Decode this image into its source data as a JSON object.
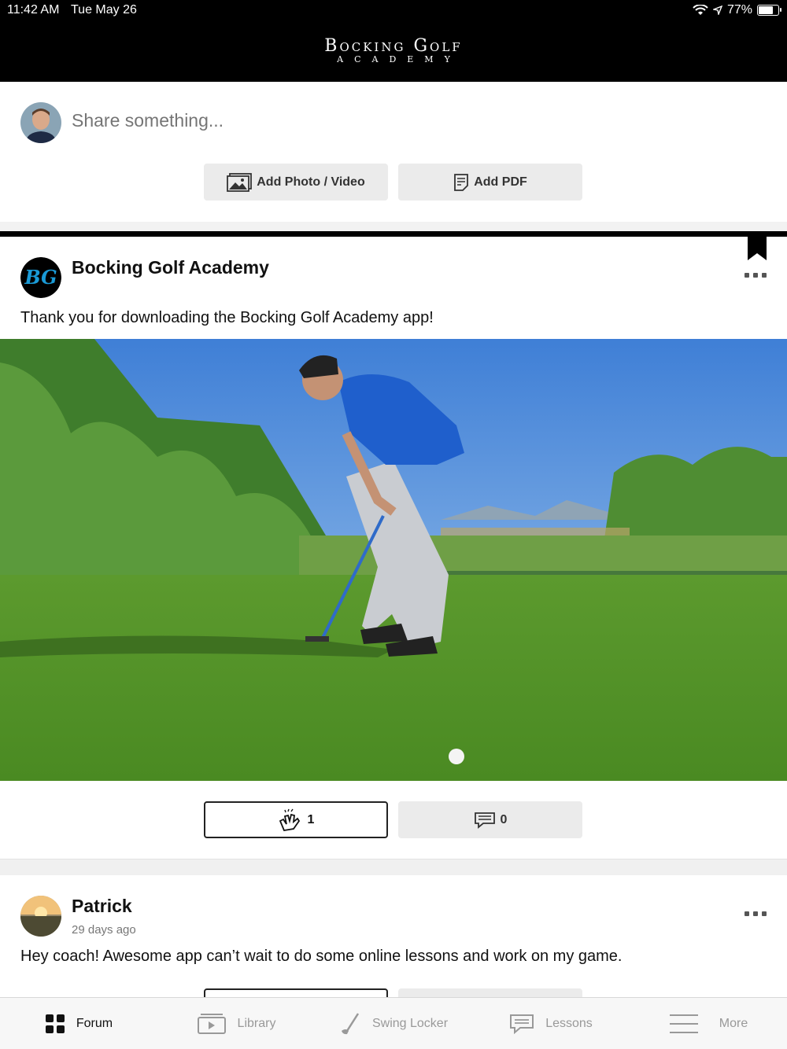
{
  "status": {
    "time": "11:42 AM",
    "date": "Tue May 26",
    "battery": "77%",
    "battery_level": 0.77
  },
  "header": {
    "logo_main": "Bocking Golf",
    "logo_sub": "ACADEMY"
  },
  "composer": {
    "placeholder": "Share something...",
    "add_photo_label": "Add Photo / Video",
    "add_pdf_label": "Add PDF"
  },
  "posts": [
    {
      "author": "Bocking Golf Academy",
      "text": "Thank you for downloading the Bocking Golf Academy app!",
      "clap_count": "1",
      "comment_count": "0"
    },
    {
      "author": "Patrick",
      "time": "29 days ago",
      "text": "Hey coach! Awesome app can’t wait to do some online lessons and work on my game."
    }
  ],
  "tabs": [
    {
      "label": "Forum",
      "icon": "grid-icon",
      "active": true
    },
    {
      "label": "Library",
      "icon": "video-folder-icon",
      "active": false
    },
    {
      "label": "Swing Locker",
      "icon": "golf-club-icon",
      "active": false
    },
    {
      "label": "Lessons",
      "icon": "chat-icon",
      "active": false
    },
    {
      "label": "More",
      "icon": "menu-icon",
      "active": false
    }
  ],
  "colors": {
    "header_bg": "#000000",
    "brand_blue": "#1a9ad6",
    "button_gray": "#ebebeb"
  }
}
